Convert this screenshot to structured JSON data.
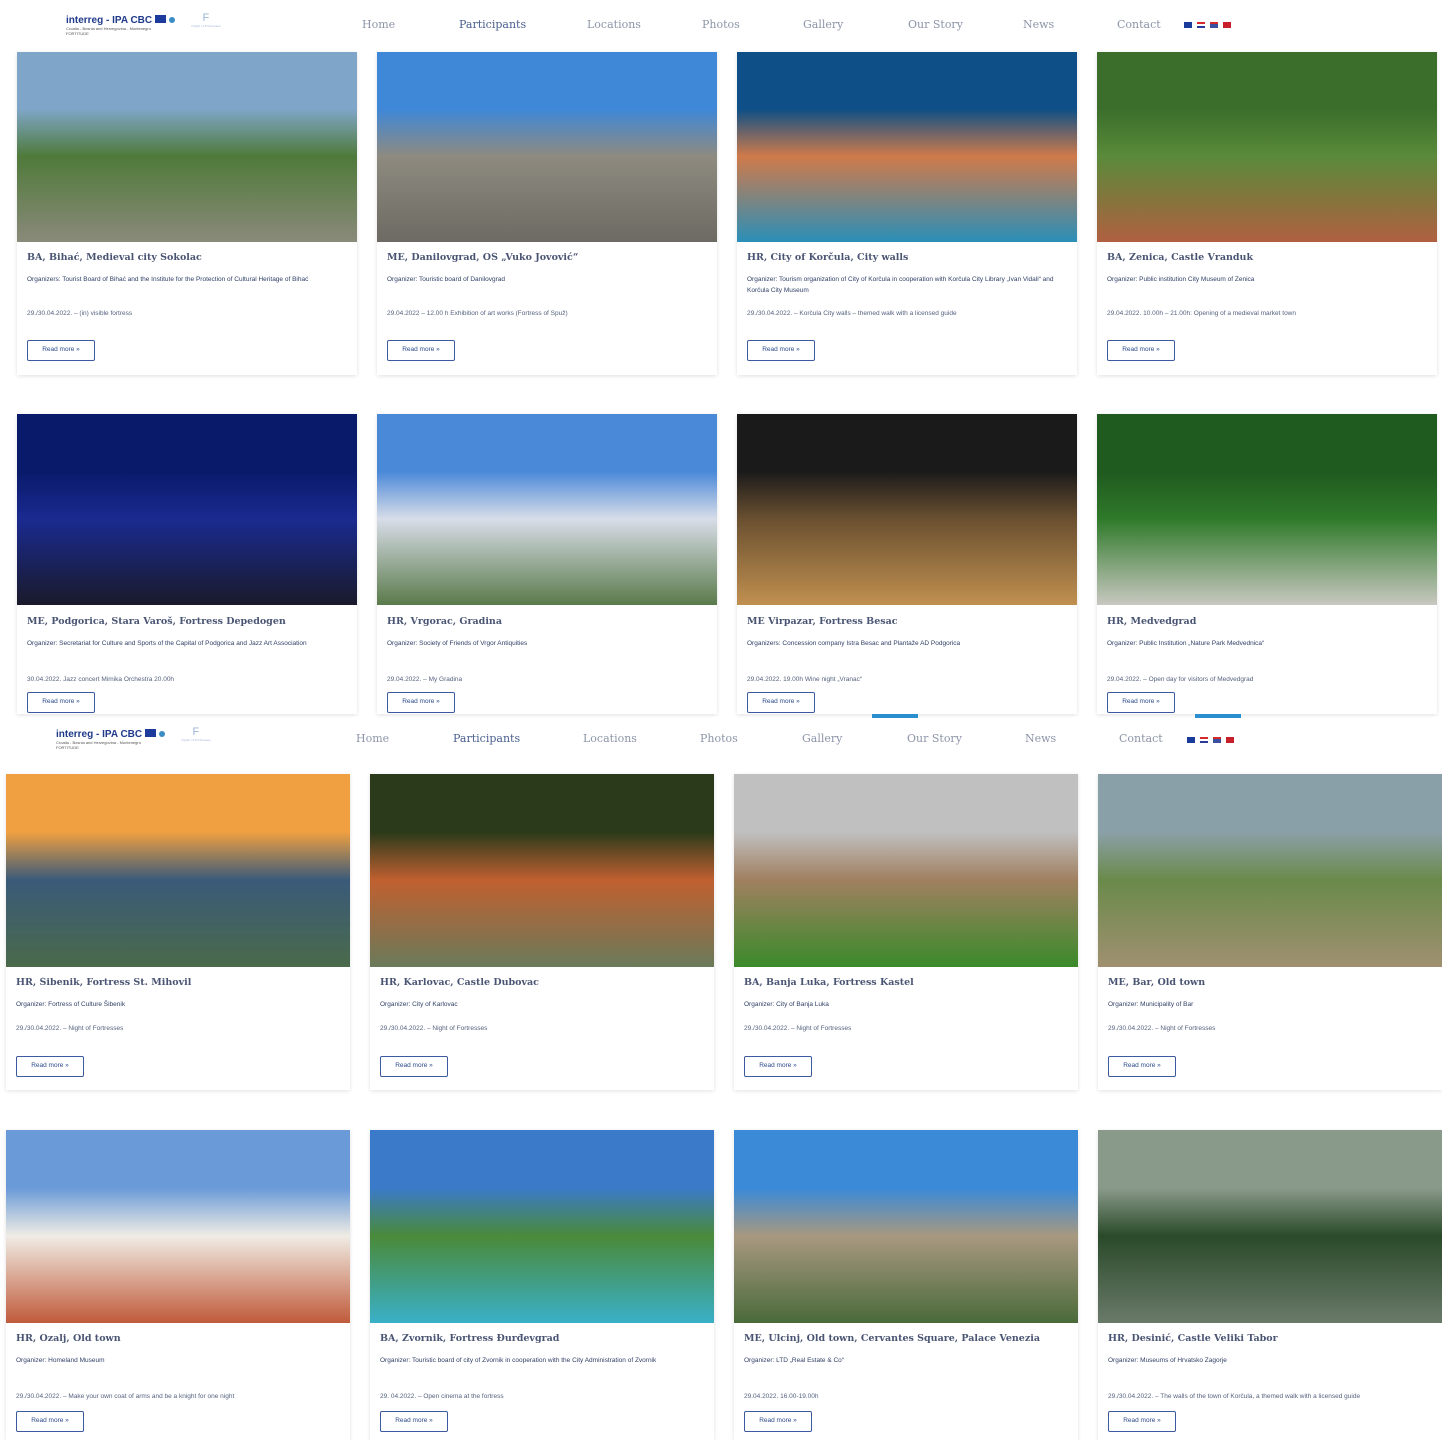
{
  "brand": {
    "logo_text": "interreg - IPA CBC",
    "logo_subtitle": "Croatia - Bosnia and Herzegovina - Montenegro",
    "logo_subtitle2": "FORTITUDE",
    "partner_logo": "F",
    "partner_sub": "Night of Fortresses"
  },
  "nav": {
    "items": [
      "Home",
      "Participants",
      "Locations",
      "Photos",
      "Gallery",
      "Our Story",
      "News",
      "Contact"
    ],
    "active": "Participants",
    "flags": [
      {
        "name": "bosnia-flag",
        "color": "#1a3b9c"
      },
      {
        "name": "croatia-flag",
        "color": "#d42a2a"
      },
      {
        "name": "uk-flag",
        "color": "#3a4fa0"
      },
      {
        "name": "montenegro-flag",
        "color": "#c8202a"
      }
    ]
  },
  "read_more": "Read more »",
  "screens": [
    {
      "cards": [
        {
          "title": "BA, Bihać, Medieval city Sokolac",
          "organizer": "Organizers: Tourist Board of Bihać and the Institute for the Protection of Cultural Heritage of Bihać",
          "date": "29./30.04.2022. – (in) visible fortress",
          "image_colors": [
            "#7fa6c8",
            "#4f7a3a",
            "#8a8a7a"
          ]
        },
        {
          "title": "ME, Danilovgrad, OŠ „Vuko Jovović“",
          "organizer": "Organizer: Touristic board of Danilovgrad",
          "date": "29.04.2022 – 12.00 h Exhibition of art works (Fortress of Spuž)",
          "image_colors": [
            "#3f88d8",
            "#8e8a80",
            "#6c6a62"
          ]
        },
        {
          "title": "HR, City of Korčula, City walls",
          "organizer": "Organizer: Tourism organization of City of Korčula in cooperation with Korčula City Library „Ivan Vidali“ and Korčula City Museum",
          "date": "29./30.04.2022. – Korčula City walls – themed walk with a licensed guide",
          "image_colors": [
            "#0d4f86",
            "#d07a4a",
            "#2a8fb8"
          ]
        },
        {
          "title": "BA, Zenica, Castle Vranduk",
          "organizer": "Organizer: Public institution City Museum of Zenica",
          "date": "29.04.2022. 10.00h – 21.00h: Opening of a medieval market town",
          "image_colors": [
            "#3a6e2a",
            "#5a8a3a",
            "#b06040"
          ]
        },
        {
          "title": "ME, Podgorica, Stara Varoš, Fortress Depedogen",
          "organizer": "Organizer: Secretariat for Culture and Sports of the Capital of Podgorica and Jazz Art Association",
          "date": "30.04.2022. Jazz concert Mimika Orchestra 20.00h",
          "image_colors": [
            "#0a1a6a",
            "#1a2a90",
            "#1a1a2a"
          ]
        },
        {
          "title": "HR, Vrgorac, Gradina",
          "organizer": "Organizer: Society of Friends of Vrgor Antiquities",
          "date": "29.04.2022. – My Gradina",
          "image_colors": [
            "#4a88d8",
            "#d8dde8",
            "#5a7a4a"
          ]
        },
        {
          "title": "ME Virpazar, Fortress Besac",
          "organizer": "Organizers: Concession company Istra Besac and Plantaže AD Podgorica",
          "date": "29.04.2022. 19.00h Wine night „Vranac“",
          "image_colors": [
            "#1a1a1a",
            "#6a5030",
            "#c09050"
          ]
        },
        {
          "title": "HR, Medvedgrad",
          "organizer": "Organizer: Public Institution „Nature Park Medvednica“",
          "date": "29.04.2022. – Open day for visitors of Medvedgrad",
          "image_colors": [
            "#1f5a1f",
            "#2f7a2a",
            "#c8c8c0"
          ]
        }
      ]
    },
    {
      "cards": [
        {
          "title": "HR, Šibenik, Fortress St. Mihovil",
          "organizer": "Organizer: Fortress of Culture Šibenik",
          "date": "29./30.04.2022. – Night of Fortresses",
          "image_colors": [
            "#f0a040",
            "#3a5a7a",
            "#4a6a4a"
          ]
        },
        {
          "title": "HR, Karlovac, Castle Dubovac",
          "organizer": "Organizer: City of Karlovac",
          "date": "29./30.04.2022. – Night of Fortresses",
          "image_colors": [
            "#2a3a1a",
            "#c06030",
            "#6a7a5a"
          ]
        },
        {
          "title": "BA, Banja Luka, Fortress Kastel",
          "organizer": "Organizer: City of Banja Luka",
          "date": "29./30.04.2022. – Night of Fortresses",
          "image_colors": [
            "#c0c0c0",
            "#a08060",
            "#3a8a2a"
          ]
        },
        {
          "title": "ME, Bar, Old town",
          "organizer": "Organizer: Municipality of Bar",
          "date": "29./30.04.2022. – Night of Fortresses",
          "image_colors": [
            "#8aa0a8",
            "#6a8a4a",
            "#a09070"
          ]
        },
        {
          "title": "HR, Ozalj, Old town",
          "organizer": "Organizer: Homeland Museum",
          "date": "29./30.04.2022. – Make your own coat of arms and be a knight for one night",
          "image_colors": [
            "#6a9ad8",
            "#f0ece4",
            "#c05a3a"
          ]
        },
        {
          "title": "BA, Zvornik, Fortress Đurđevgrad",
          "organizer": "Organizer: Touristic board of city of Zvornik in cooperation with the City Administration of Zvornik",
          "date": "29. 04.2022. – Open cinema at the fortress",
          "image_colors": [
            "#3a7ac8",
            "#4a8a3a",
            "#3ab0c8"
          ]
        },
        {
          "title": "ME, Ulcinj, Old town, Cervantes Square, Palace Venezia",
          "organizer": "Organizer: LTD „Real Estate & Co“",
          "date": "29.04.2022. 16.00-19.00h",
          "image_colors": [
            "#3a8ad8",
            "#a89880",
            "#4a6a3a"
          ]
        },
        {
          "title": "HR, Desinić, Castle Veliki Tabor",
          "organizer": "Organizer: Museums of Hrvatsko Zagorje",
          "date": "29./30.04.2022. – The walls of the town of Korčula, a themed walk with a licensed guide",
          "image_colors": [
            "#8a9a8a",
            "#2a4a2a",
            "#6a7a6a"
          ]
        }
      ]
    }
  ]
}
